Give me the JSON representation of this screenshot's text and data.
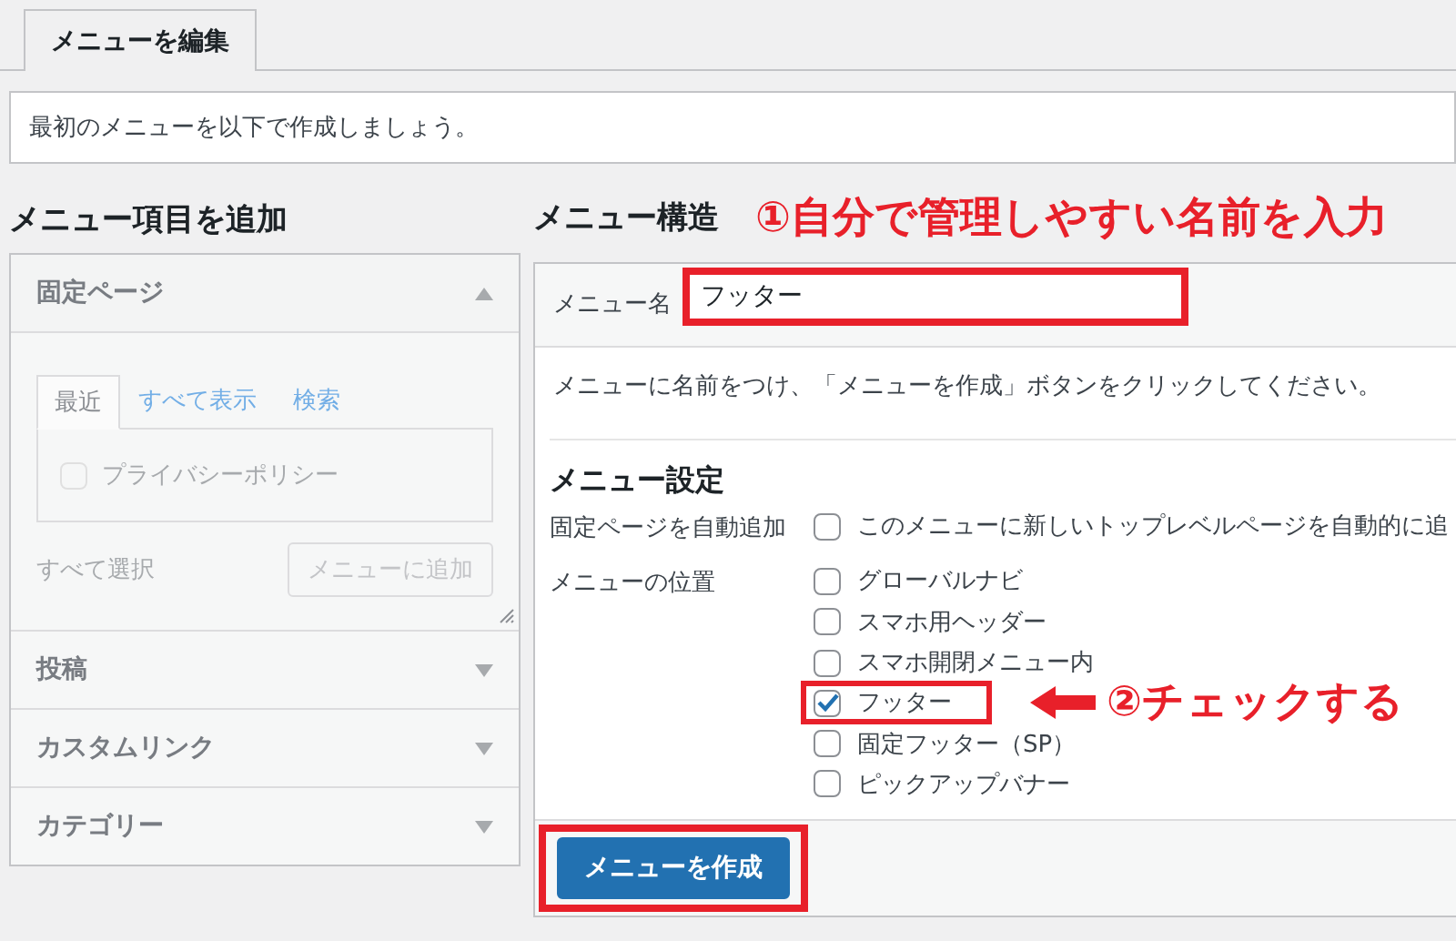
{
  "tabs": [
    {
      "label": "メニューを編集",
      "selected": true
    }
  ],
  "notice": "最初のメニューを以下で作成しましょう。",
  "add_items": {
    "title": "メニュー項目を追加",
    "sections": [
      {
        "title": "固定ページ",
        "expanded": true,
        "tabs": [
          {
            "label": "最近",
            "selected": true
          },
          {
            "label": "すべて表示",
            "selected": false
          },
          {
            "label": "検索",
            "selected": false
          }
        ],
        "items": [
          {
            "label": "プライバシーポリシー",
            "checked": false
          }
        ],
        "select_all": "すべて選択",
        "add_button": {
          "label": "メニューに追加",
          "disabled": true
        }
      },
      {
        "title": "投稿",
        "expanded": false
      },
      {
        "title": "カスタムリンク",
        "expanded": false
      },
      {
        "title": "カテゴリー",
        "expanded": false
      }
    ]
  },
  "structure": {
    "title": "メニュー構造",
    "annotation": "①自分で管理しやすい名前を入力",
    "name_label": "メニュー名",
    "name_value": "フッター",
    "name_highlighted": true,
    "instructions": "メニューに名前をつけ、「メニューを作成」ボタンをクリックしてください。",
    "settings_title": "メニュー設定",
    "settings": [
      {
        "label": "固定ページを自動追加",
        "options": [
          {
            "label": "このメニューに新しいトップレベルページを自動的に追",
            "checked": false,
            "highlighted": false
          }
        ]
      },
      {
        "label": "メニューの位置",
        "options": [
          {
            "label": "グローバルナビ",
            "checked": false,
            "highlighted": false
          },
          {
            "label": "スマホ用ヘッダー",
            "checked": false,
            "highlighted": false
          },
          {
            "label": "スマホ開閉メニュー内",
            "checked": false,
            "highlighted": false
          },
          {
            "label": "フッター",
            "checked": true,
            "highlighted": true,
            "annotation": "②チェックする"
          },
          {
            "label": "固定フッター（SP）",
            "checked": false,
            "highlighted": false
          },
          {
            "label": "ピックアップバナー",
            "checked": false,
            "highlighted": false
          }
        ]
      }
    ],
    "create_button": {
      "label": "メニューを作成",
      "highlighted": true
    }
  }
}
